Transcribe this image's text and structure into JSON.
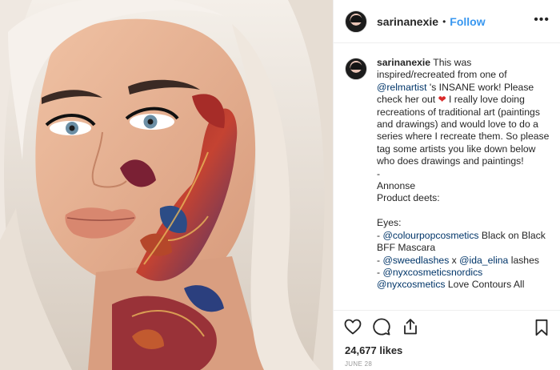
{
  "post": {
    "photo_alt": "Makeup art photo",
    "header": {
      "username": "sarinanexie",
      "separator": "•",
      "follow_label": "Follow",
      "more_label": "•••"
    },
    "caption": {
      "username": "sarinanexie",
      "text_1": "This was inspired/recreated from one of ",
      "mention_1": "@relmartist",
      "text_2": " 's INSANE work! Please check her out ",
      "heart": "❤",
      "text_3": " I really love doing recreations of traditional art (paintings and drawings) and would love to do a series where I recreate them. So please tag some artists you like down below who does drawings and paintings!",
      "dash": "-",
      "annonse": "Annonse",
      "product_deets": "Product deets:",
      "eyes": "Eyes:",
      "line1_prefix": "- ",
      "line1_mention": "@colourpopcosmetics",
      "line1_rest": " Black on Black BFF Mascara",
      "line2_prefix": "- ",
      "line2_mention_a": "@sweedlashes",
      "line2_mid": " x ",
      "line2_mention_b": "@ida_elina",
      "line2_rest": " lashes",
      "line3_prefix": "- ",
      "line3_mention": "@nyxcosmeticsnordics",
      "line4_mention": "@nyxcosmetics",
      "line4_rest": " Love Contours All"
    },
    "actions": {
      "like_icon": "heart-outline-icon",
      "comment_icon": "comment-icon",
      "share_icon": "share-icon",
      "save_icon": "bookmark-icon"
    },
    "likes": "24,677 likes",
    "date": "JUNE 28",
    "colors": {
      "link": "#3897f0",
      "mention": "#003569",
      "text": "#262626",
      "muted": "#999999",
      "heart": "#d92a2a"
    }
  }
}
